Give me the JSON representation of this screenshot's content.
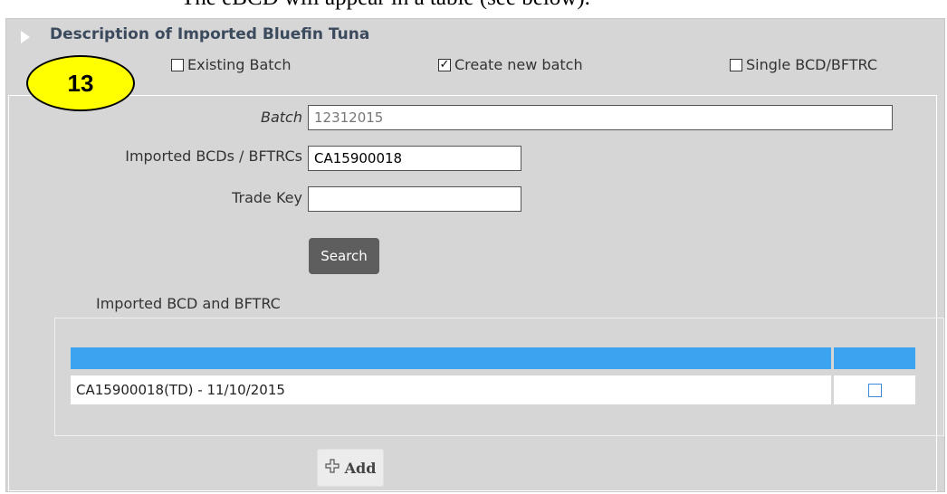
{
  "doc_text": {
    "bullet": "•",
    "line": "The eBCD will appear in a table (see below)."
  },
  "panel": {
    "title": "Description of Imported Bluefin Tuna"
  },
  "callout": {
    "number": "13"
  },
  "batch_options": [
    {
      "label": "Existing Batch",
      "checked": false
    },
    {
      "label": "Create new batch",
      "checked": true
    },
    {
      "label": "Single BCD/BFTRC",
      "checked": false
    }
  ],
  "form": {
    "batch_label": "Batch",
    "batch_value": "12312015",
    "imported_label": "Imported BCDs / BFTRCs",
    "imported_value": "CA15900018",
    "trade_key_label": "Trade Key",
    "trade_key_value": "",
    "search_label": "Search"
  },
  "imported_section": {
    "title": "Imported BCD and BFTRC",
    "rows": [
      {
        "text": "CA15900018(TD) - 11/10/2015",
        "checked": false
      }
    ]
  },
  "add_button": {
    "label": "Add"
  },
  "colors": {
    "panel_bg": "#d6d6d6",
    "table_header": "#3ba3f0",
    "callout_fill": "#ffff00",
    "search_btn": "#5e5e5e"
  }
}
